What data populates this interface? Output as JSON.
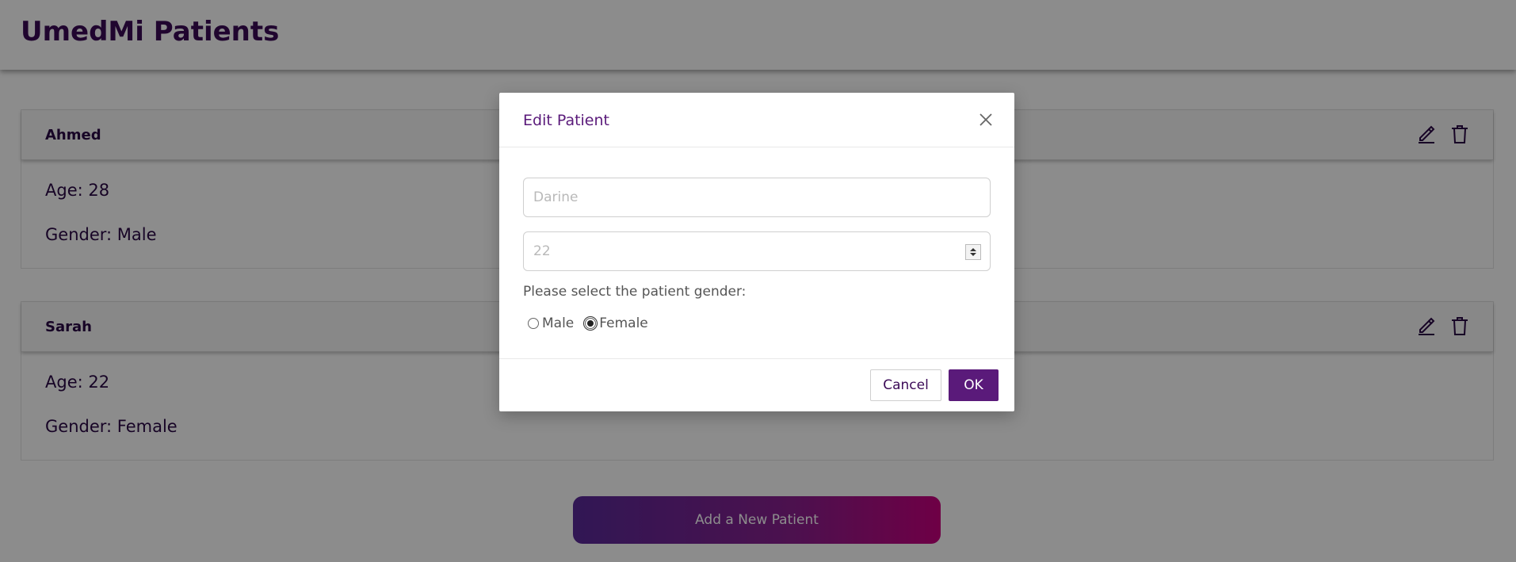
{
  "app": {
    "title": "UmedMi Patients"
  },
  "patients": [
    {
      "name": "Ahmed",
      "age_line": "Age: 28",
      "gender_line": "Gender: Male"
    },
    {
      "name": "Sarah",
      "age_line": "Age: 22",
      "gender_line": "Gender: Female"
    }
  ],
  "add_button_label": "Add a New Patient",
  "modal": {
    "title": "Edit Patient",
    "name_placeholder": "Darine",
    "age_placeholder": "22",
    "gender_prompt": "Please select the patient gender:",
    "gender_options": [
      {
        "label": "Male",
        "selected": false
      },
      {
        "label": "Female",
        "selected": true
      }
    ],
    "cancel_label": "Cancel",
    "ok_label": "OK"
  },
  "colors": {
    "brand": "#3b0a57",
    "accent": "#5a1a7a",
    "gradient_start": "#5a2a9a",
    "gradient_end": "#c9007f"
  }
}
